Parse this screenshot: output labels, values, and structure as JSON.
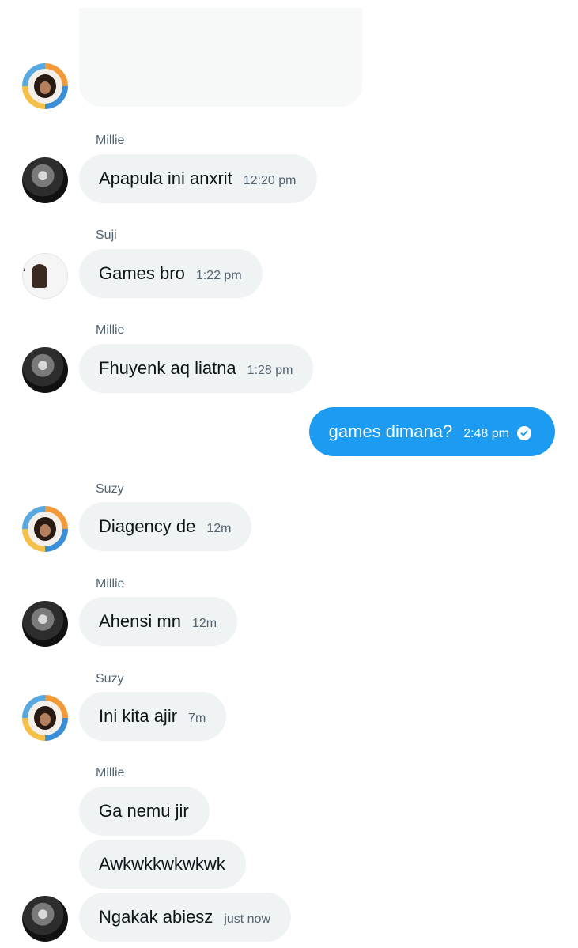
{
  "conversation": {
    "messages": [
      {
        "sender": "Millie",
        "text": "Apapula ini anxrit",
        "time": "12:20 pm"
      },
      {
        "sender": "Suji",
        "text": "Games bro",
        "time": "1:22 pm"
      },
      {
        "sender": "Millie",
        "text": "Fhuyenk aq liatna",
        "time": "1:28 pm"
      },
      {
        "sender": "me",
        "text": "games dimana?",
        "time": "2:48 pm",
        "status_icon": "check-circle-icon"
      },
      {
        "sender": "Suzy",
        "text": "Diagency de",
        "time": "12m"
      },
      {
        "sender": "Millie",
        "text": "Ahensi mn",
        "time": "12m"
      },
      {
        "sender": "Suzy",
        "text": "Ini kita ajir",
        "time": "7m"
      },
      {
        "sender": "Millie",
        "text": "Ga nemu jir"
      },
      {
        "sender": "Millie",
        "text": "Awkwkkwkwkwk"
      },
      {
        "sender": "Millie",
        "text": "Ngakak abiesz",
        "time": "just now"
      }
    ]
  },
  "colors": {
    "incoming_bubble": "#eff3f4",
    "outgoing_bubble": "#1d9bf0",
    "secondary_text": "#536471"
  }
}
